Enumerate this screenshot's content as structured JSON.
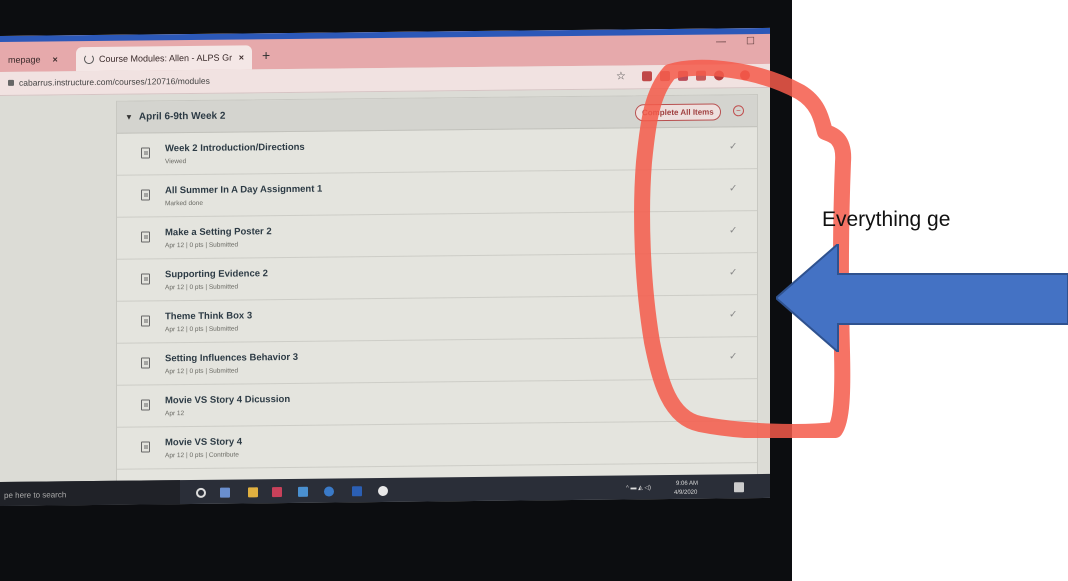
{
  "browser": {
    "tab_home": "mepage",
    "tab_active": "Course Modules: Allen - ALPS Gr",
    "tab_close": "×",
    "new_tab": "+",
    "address": "cabarrus.instructure.com/courses/120716/modules"
  },
  "module": {
    "title": "April 6-9th Week 2",
    "complete_all_label": "Complete All Items",
    "items": [
      {
        "title": "Week 2 Introduction/Directions",
        "sub": "Viewed",
        "checked": true
      },
      {
        "title": "All Summer In A Day Assignment 1",
        "sub": "Marked done",
        "checked": true
      },
      {
        "title": "Make a Setting Poster 2",
        "sub": "Apr 12 | 0 pts | Submitted",
        "checked": true
      },
      {
        "title": "Supporting Evidence 2",
        "sub": "Apr 12 | 0 pts | Submitted",
        "checked": true
      },
      {
        "title": "Theme Think Box 3",
        "sub": "Apr 12 | 0 pts | Submitted",
        "checked": true
      },
      {
        "title": "Setting Influences Behavior 3",
        "sub": "Apr 12 | 0 pts | Submitted",
        "checked": true
      },
      {
        "title": "Movie VS Story 4 Dicussion",
        "sub": "Apr 12",
        "checked": false
      },
      {
        "title": "Movie VS Story 4",
        "sub": "Apr 12 | 0 pts | Contribute",
        "checked": false
      }
    ]
  },
  "taskbar": {
    "search_placeholder": "pe here to search",
    "time": "9:06 AM",
    "date": "4/9/2020"
  },
  "annotation": {
    "text": "Everything ge",
    "outline_color": "#f45a4a",
    "arrow_color": "#4472c4"
  },
  "icons": [
    "lock-icon",
    "star-icon",
    "caret-down-icon",
    "document-icon",
    "checkmark-icon",
    "minus-circle-icon",
    "windows-start-icon"
  ]
}
